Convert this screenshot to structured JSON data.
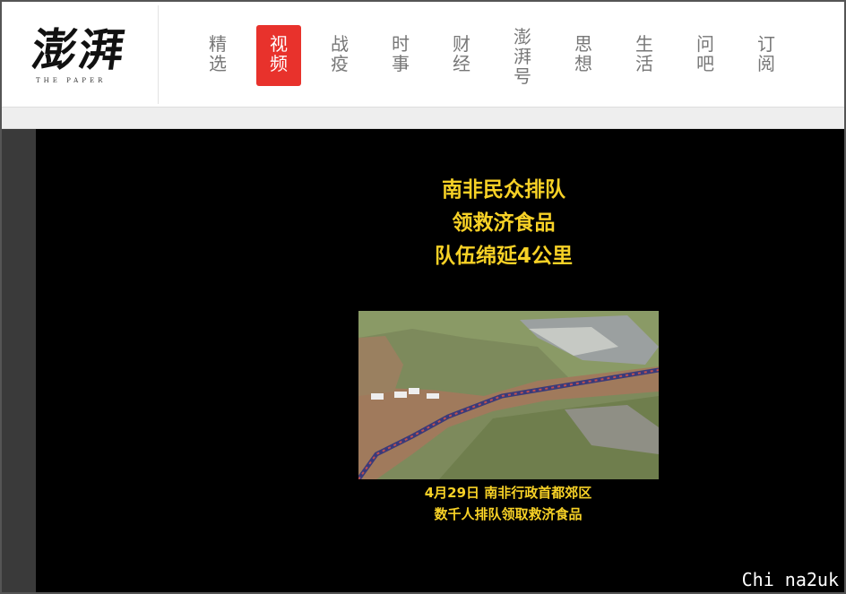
{
  "logo": {
    "main": "澎湃",
    "sub": "THE PAPER"
  },
  "nav": {
    "items": [
      {
        "label": "精选"
      },
      {
        "label": "视频",
        "active": true
      },
      {
        "label": "战疫"
      },
      {
        "label": "时事"
      },
      {
        "label": "财经"
      },
      {
        "label": "澎湃号"
      },
      {
        "label": "思想"
      },
      {
        "label": "生活"
      },
      {
        "label": "问吧"
      },
      {
        "label": "订阅"
      }
    ]
  },
  "video": {
    "title_lines": [
      "南非民众排队",
      "领救济食品",
      "队伍绵延4公里"
    ],
    "caption_lines": [
      "4月29日 南非行政首都郊区",
      "数千人排队领取救济食品"
    ]
  },
  "watermark": "Chi na2uk",
  "colors": {
    "accent": "#e8322c",
    "title_yellow": "#f7d126",
    "video_bg": "#000000"
  }
}
